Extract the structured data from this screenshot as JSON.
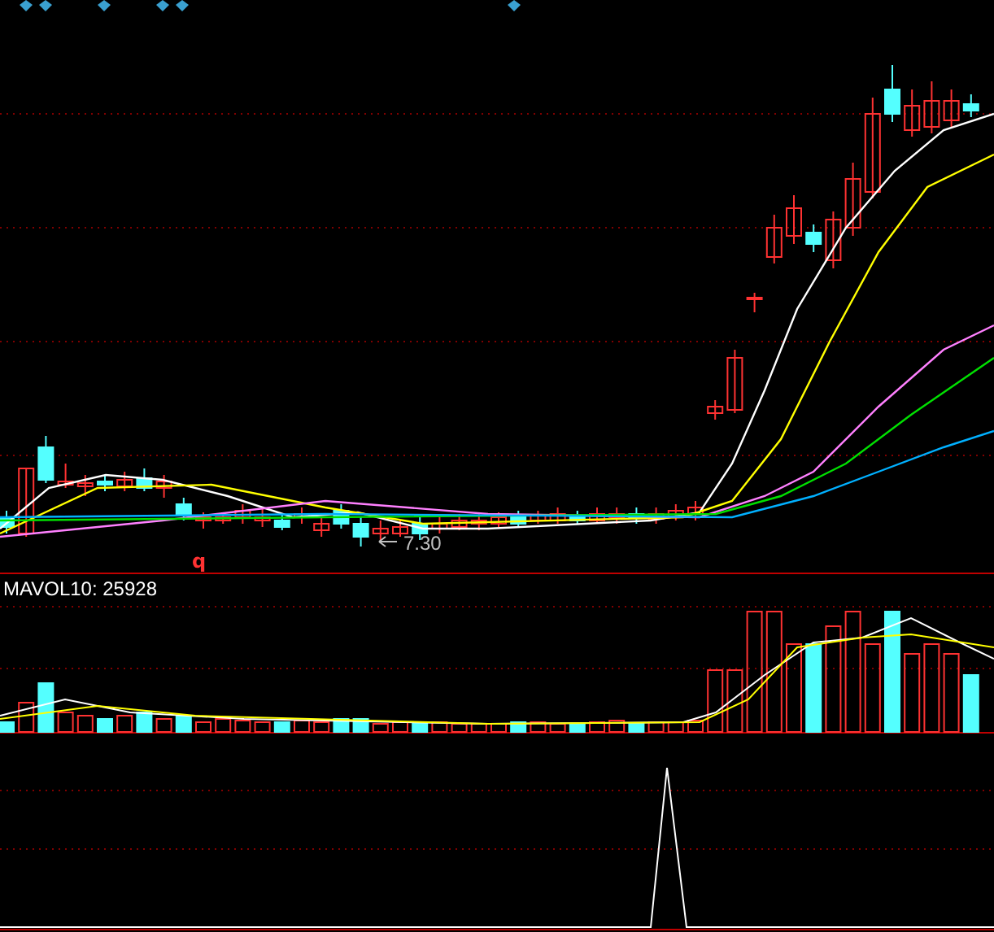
{
  "price_panel": {
    "low_marker": "q",
    "price_label": "7.30"
  },
  "volume_panel": {
    "indicator": "MAVOL10: 25928"
  }
}
